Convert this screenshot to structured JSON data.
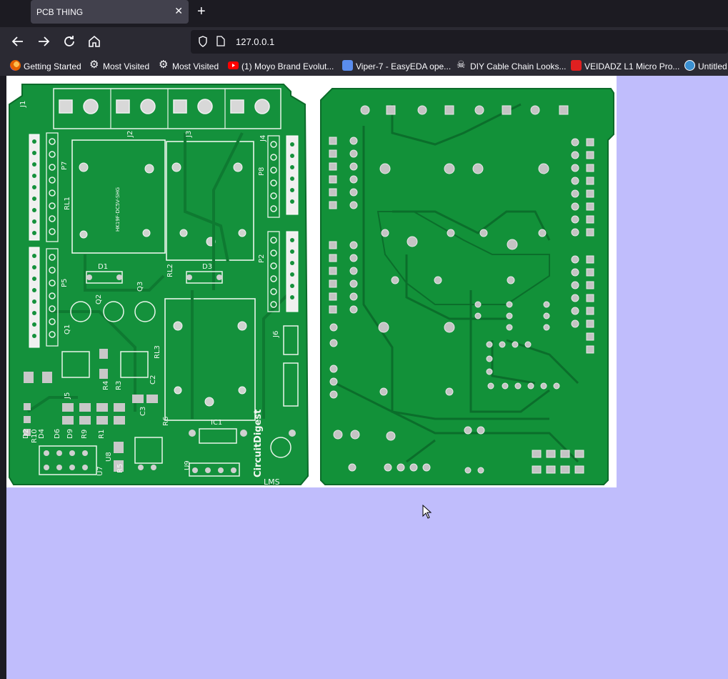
{
  "tab": {
    "title": "PCB THING",
    "close_glyph": "✕"
  },
  "new_tab_glyph": "+",
  "nav": {
    "back_icon": "back-arrow-icon",
    "forward_icon": "forward-arrow-icon",
    "reload_icon": "reload-icon",
    "home_icon": "home-icon"
  },
  "url": {
    "text": "127.0.0.1"
  },
  "bookmarks": [
    {
      "label": "Getting Started",
      "icon": "firefox-icon",
      "color": "#e66000"
    },
    {
      "label": "Most Visited",
      "icon": "gear-icon",
      "color": "#fbfbfe"
    },
    {
      "label": "Most Visited",
      "icon": "gear-icon",
      "color": "#fbfbfe"
    },
    {
      "label": "(1) Moyo Brand Evolut...",
      "icon": "youtube-icon",
      "color": "#ff0000"
    },
    {
      "label": "Viper-7 - EasyEDA ope...",
      "icon": "easyeda-icon",
      "color": "#5a8dee"
    },
    {
      "label": "DIY Cable Chain Looks...",
      "icon": "skull-icon",
      "color": "#fbfbfe"
    },
    {
      "label": "VEIDADZ L1 Micro Pro...",
      "icon": "cart-icon",
      "color": "#e02020"
    },
    {
      "label": "Untitled",
      "icon": "wordpress-icon",
      "color": "#3a8fd0"
    }
  ],
  "pcb_labels": {
    "j1": "J1",
    "j2": "J2",
    "j3": "J3",
    "j4": "J4",
    "p7": "P7",
    "p8": "P8",
    "p5": "P5",
    "p2": "P2",
    "rl1": "RL1",
    "rl2": "RL2",
    "rl3": "RL3",
    "q1": "Q1",
    "q2": "Q2",
    "q3": "Q3",
    "d1": "D1",
    "d3": "D3",
    "j5": "J5",
    "j6": "J6",
    "r4": "R4",
    "r3": "R3",
    "r6": "R6",
    "r5": "R5",
    "d2": "D2",
    "d4": "D4",
    "d6": "D6",
    "d9": "D9",
    "r9": "R9",
    "r1": "R1",
    "r10": "R10",
    "u7": "U7",
    "u8": "U8",
    "u9": "U9",
    "ic1": "IC1",
    "c3": "C3",
    "c2": "C2",
    "brand": "CircuitDigest",
    "lm": "LMS",
    "part": "HK19F-DC5V-SHG"
  },
  "colors": {
    "accent_bg": "#c0bdfc",
    "pcb_green": "#14913c"
  }
}
